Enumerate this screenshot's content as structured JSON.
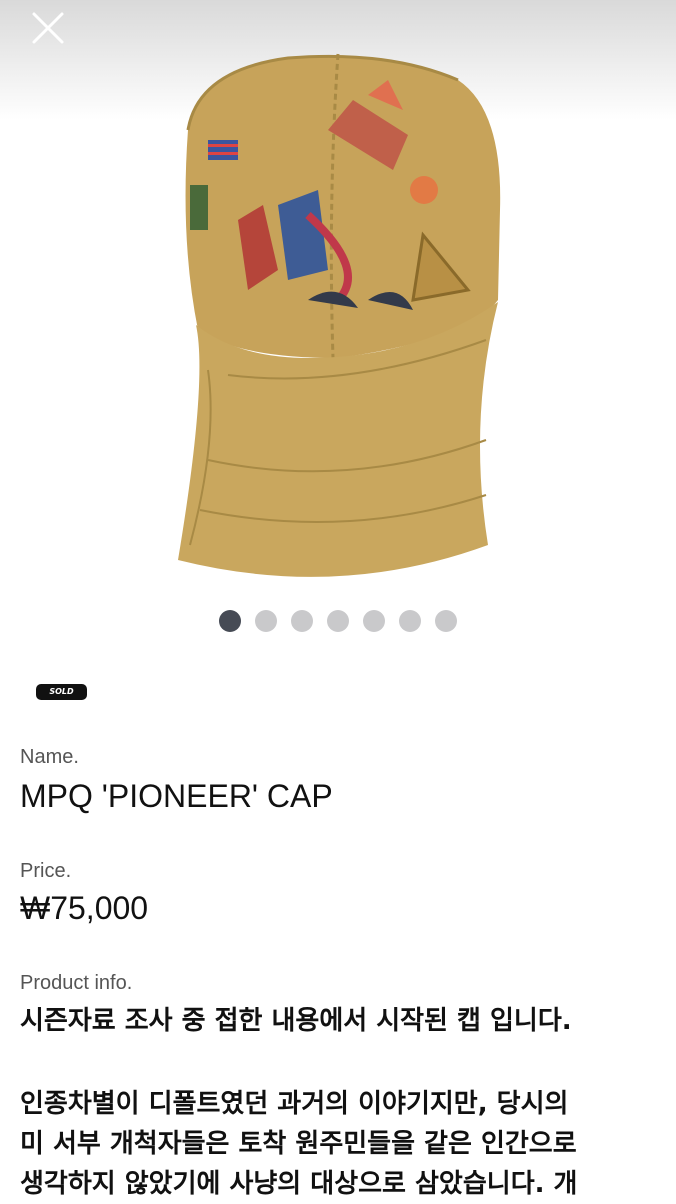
{
  "hero": {
    "image_alt": "MPQ PIONEER embroidered cap"
  },
  "carousel": {
    "count": 7,
    "active": 1
  },
  "product": {
    "badge": "SOLD",
    "name_label": "Name.",
    "name": "MPQ 'PIONEER' CAP",
    "price_label": "Price.",
    "price": "₩75,000",
    "info_label": "Product info.",
    "info_line1": "시즌자료 조사 중 접한 내용에서 시작된 캡 입니다.",
    "info_line2": "인종차별이 디폴트였던 과거의 이야기지만, 당시의",
    "info_line3": "미 서부 개척자들은 토착 원주민들을 같은 인간으로",
    "info_line4": "생각하지 않았기에 사냥의 대상으로 삼았습니다. 개"
  },
  "icons": {
    "close": "close-icon"
  }
}
